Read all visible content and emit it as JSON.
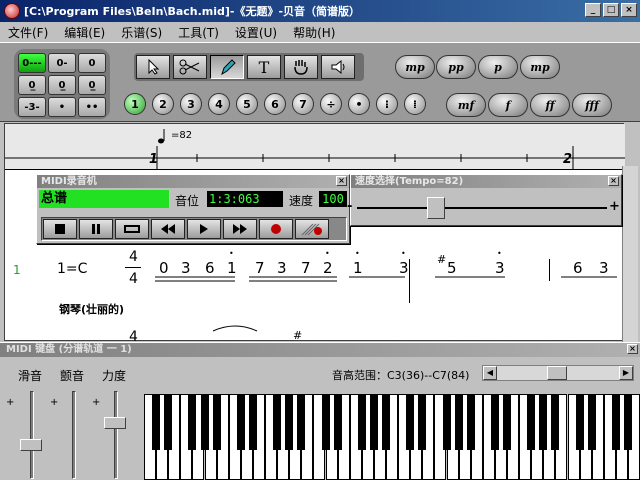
{
  "window": {
    "title": "[C:\\Program Files\\BeIn\\Bach.mid]-《无题》-贝音（简谱版）"
  },
  "menu": [
    "文件(F)",
    "编辑(E)",
    "乐谱(S)",
    "工具(T)",
    "设置(U)",
    "帮助(H)"
  ],
  "notepad": [
    "0---",
    "0-",
    "0",
    "0̲",
    "0̲̲",
    "0̲̲̲",
    "-3-",
    "•",
    "••"
  ],
  "tools": [
    "arrow",
    "scissors",
    "pen",
    "T",
    "hand",
    "speaker"
  ],
  "tool_labels": {
    "text": "T"
  },
  "numbers": [
    "1",
    "2",
    "3",
    "4",
    "5",
    "6",
    "7",
    "÷",
    "•",
    "⁝",
    "⁞"
  ],
  "dynamics": [
    "mp",
    "pp",
    "p",
    "mp",
    "mf",
    "f",
    "ff",
    "fff"
  ],
  "ruler": {
    "tempo": "=82",
    "bar1": "1",
    "bar2": "2"
  },
  "recorder": {
    "title": "MIDI录音机",
    "track": "总谱",
    "pos_label": "音位",
    "pos": "1:3:063",
    "speed_label": "速度",
    "speed": "100"
  },
  "tempo_win": {
    "title": "速度选择(Tempo=82)",
    "minus": "-",
    "plus": "+"
  },
  "score": {
    "line": "1",
    "key": "1=C",
    "ts_top": "4",
    "ts_bot": "4",
    "instrument": "钢琴(壮丽的)",
    "ts2": "4",
    "sharp": "#"
  },
  "keyboard": {
    "title": "MIDI 键盘 (分谱轨道 一 1)",
    "l1": "滑音",
    "l2": "颤音",
    "l3": "力度",
    "range_label": "音高范围：C3(36)--C7(84)",
    "plus": "+"
  },
  "notes": [
    {
      "t": "0",
      "u": false,
      "d": false
    },
    {
      "t": "3",
      "u": false,
      "d": false
    },
    {
      "t": "6",
      "u": false,
      "d": false
    },
    {
      "t": "1",
      "u": true,
      "d": false
    },
    {
      "t": "7",
      "u": false,
      "d": false
    },
    {
      "t": "3",
      "u": false,
      "d": false
    },
    {
      "t": "7",
      "u": false,
      "d": false
    },
    {
      "t": "2",
      "u": true,
      "d": false
    },
    {
      "t": "1",
      "u": true,
      "d": false
    },
    {
      "t": "3",
      "u": true,
      "d": false
    },
    {
      "t": "5",
      "u": false,
      "d": false
    },
    {
      "t": "3",
      "u": true,
      "d": false
    },
    {
      "t": "6",
      "u": false,
      "d": false
    },
    {
      "t": "3",
      "u": false,
      "d": false
    }
  ],
  "colors": {
    "active_green": "#22e022",
    "lcd_bg": "#000000",
    "lcd_fg": "#40ff40",
    "record_red": "#c00000"
  }
}
